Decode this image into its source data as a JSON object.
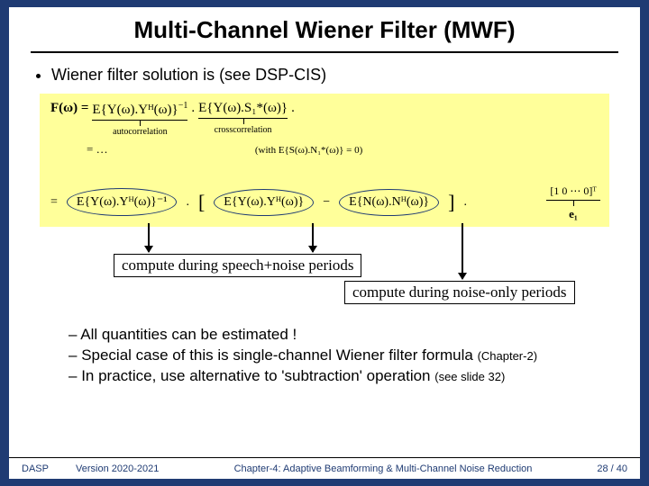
{
  "title": "Multi-Channel Wiener Filter (MWF)",
  "bullet_main": "Wiener filter solution is (see DSP-CIS)",
  "formula": {
    "lhs": "F(ω) =",
    "auto_expr": "E{Y(ω).Yᴴ(ω)}",
    "auto_exp": "−1",
    "auto_label": "autocorrelation",
    "cross_expr": "E{Y(ω).S₁*(ω)}",
    "cross_label": "crosscorrelation",
    "dot": ".",
    "mid": "= …",
    "mid_note": "(with E{S(ω).N₁*(ω)} = 0)",
    "row2_eq": "=",
    "ell1": "E{Y(ω).Yᴴ(ω)}⁻¹",
    "dot2": ".",
    "brL": "[",
    "ell2": "E{Y(ω).Yᴴ(ω)}",
    "minus": "−",
    "ell3": "E{N(ω).Nᴴ(ω)}",
    "brR": "]",
    "dot3": ".",
    "evec_row": "[1 0 ⋯ 0]ᵀ",
    "evec_lbl": "e₁"
  },
  "tag1": "compute during speech+noise periods",
  "tag2": "compute during noise-only periods",
  "subs": {
    "a": "All quantities can be estimated !",
    "b_pre": "Special case of this is single-channel Wiener filter formula ",
    "b_note": "(Chapter-2)",
    "c_pre": "In practice, use alternative to 'subtraction' operation ",
    "c_note": "(see slide 32)"
  },
  "footer": {
    "f1": "DASP",
    "f2": "Version 2020-2021",
    "f3": "Chapter-4: Adaptive Beamforming & Multi-Channel Noise Reduction",
    "f4": "28 / 40"
  }
}
